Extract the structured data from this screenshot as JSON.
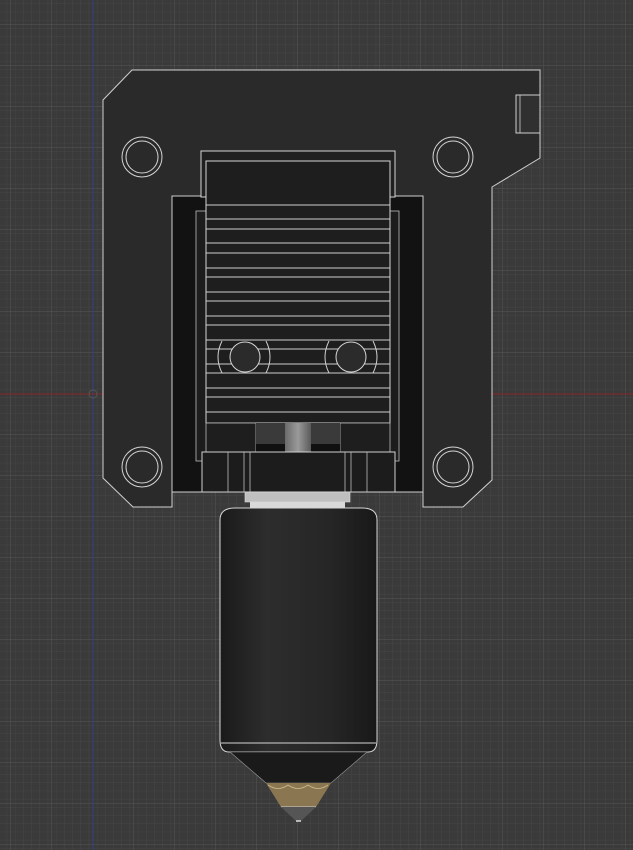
{
  "viewport": {
    "view": "cad-3d-viewport",
    "model": "hotend-assembly",
    "colors": {
      "background": "#3a3a3a",
      "grid_minor": "#444444",
      "grid_major": "#4f4f4f",
      "axis_x": "#8a2b2b",
      "axis_y": "#2f3f8a",
      "part_dark": "#262626",
      "part_black": "#141414",
      "edge": "#cfcfcf",
      "brass": "#8a7650",
      "heater": "#cfcfcf"
    }
  }
}
